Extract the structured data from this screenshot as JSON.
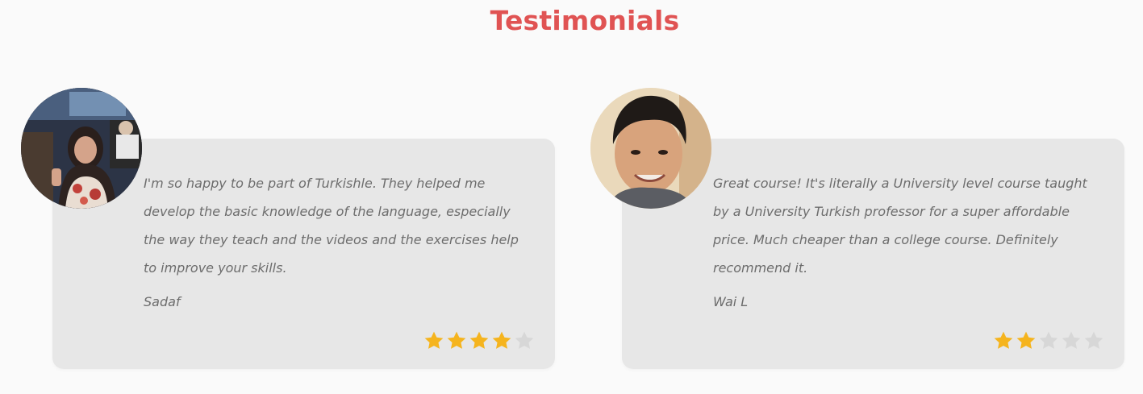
{
  "section": {
    "title": "Testimonials"
  },
  "testimonials": [
    {
      "quote": "I'm so happy to be part of Turkishle. They helped me develop the basic knowledge of the language, especially the way they teach and the videos and the exercises help to improve your skills.",
      "author": "Sadaf",
      "rating": 4,
      "max_rating": 5,
      "avatar": "user-photo-woman"
    },
    {
      "quote": "Great course! It's literally a University level course taught by a University Turkish professor for a super affordable price. Much cheaper than a college course. Definitely recommend it.",
      "author": "Wai L",
      "rating": 2,
      "max_rating": 5,
      "avatar": "user-photo-man"
    }
  ],
  "colors": {
    "title": "#e05353",
    "card_bg": "#e7e7e7",
    "star_on": "#f5b41e",
    "star_off": "#d7d7d7",
    "text": "#6d6d6d"
  }
}
